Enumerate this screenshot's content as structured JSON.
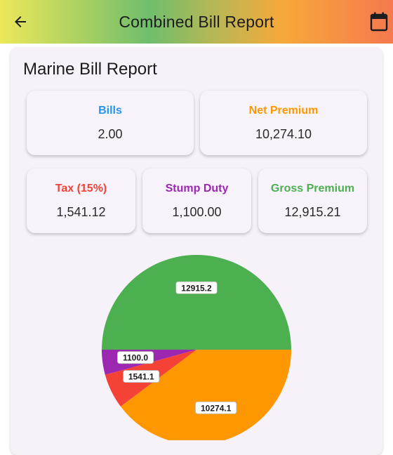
{
  "appbar": {
    "title": "Combined Bill Report",
    "back_icon": "arrow-left-icon",
    "calendar_icon": "calendar-icon"
  },
  "report": {
    "title": "Marine Bill Report",
    "stats": {
      "bills": {
        "label": "Bills",
        "value": "2.00",
        "color": "#2196f3"
      },
      "net_premium": {
        "label": "Net Premium",
        "value": "10,274.10",
        "color": "#ff9800"
      },
      "tax": {
        "label": "Tax (15%)",
        "value": "1,541.12",
        "color": "#f44336"
      },
      "stump_duty": {
        "label": "Stump Duty",
        "value": "1,100.00",
        "color": "#9c27b0"
      },
      "gross_premium": {
        "label": "Gross Premium",
        "value": "12,915.21",
        "color": "#4caf50"
      }
    }
  },
  "chart_data": {
    "type": "pie",
    "slices": [
      {
        "label": "12915.2",
        "value": 12915.21,
        "color": "#4caf50"
      },
      {
        "label": "10274.1",
        "value": 10274.1,
        "color": "#ff9800"
      },
      {
        "label": "1541.1",
        "value": 1541.12,
        "color": "#f44336"
      },
      {
        "label": "1100.0",
        "value": 1100.0,
        "color": "#9c27b0"
      }
    ]
  }
}
